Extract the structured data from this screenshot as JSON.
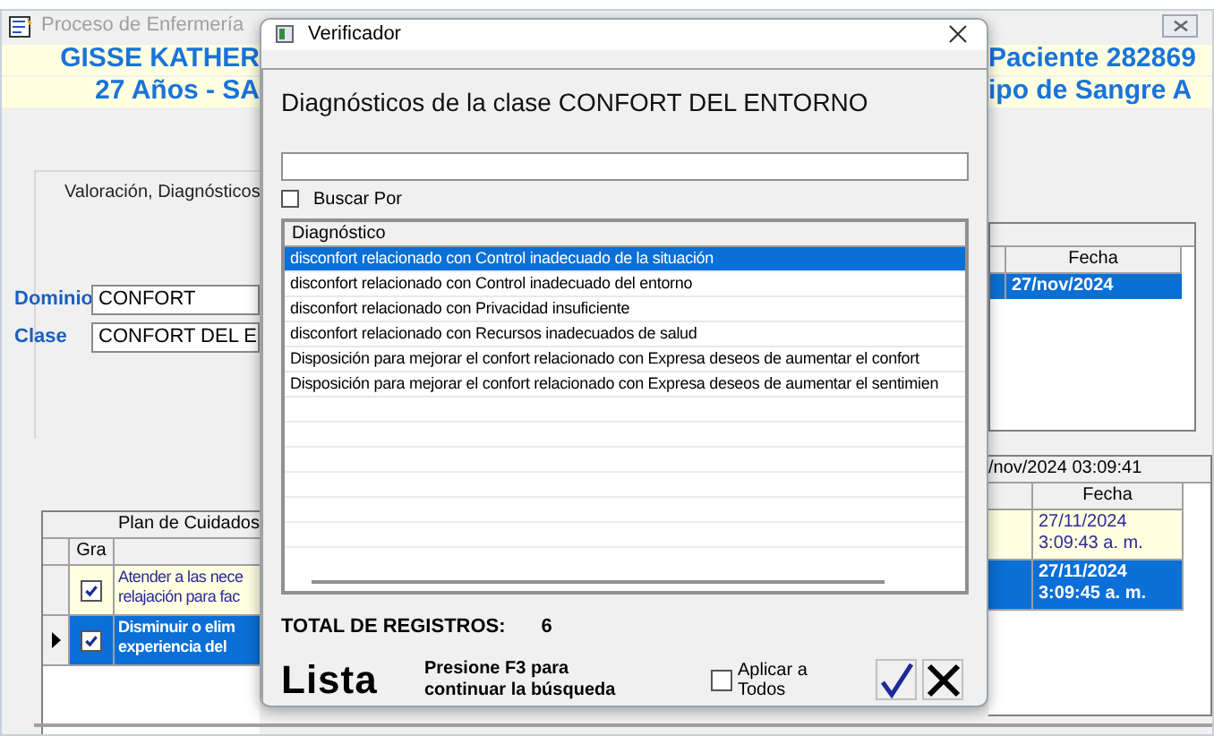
{
  "main_window": {
    "title": "Proceso de Enfermería",
    "header_left": [
      "GISSE KATHER",
      "27 Años  -  SA"
    ],
    "header_right": [
      "Paciente 282869",
      "ipo de Sangre A"
    ],
    "group_title": "Valoración, Diagnósticos",
    "fields": [
      {
        "label": "Dominio",
        "value": "CONFORT"
      },
      {
        "label": "Clase",
        "value": "CONFORT DEL E"
      }
    ],
    "diag_table": {
      "column": "Fecha",
      "rows": [
        {
          "fecha": "27/nov/2024",
          "selected": true
        }
      ]
    },
    "plan_table": {
      "title_left": "Plan de Cuidados",
      "title_right": "/nov/2024  03:09:41",
      "column_left": "Gra",
      "column_right": "Fecha",
      "rows": [
        {
          "checked": true,
          "selected": false,
          "text": [
            "Atender a las nece",
            "relajación para fac"
          ],
          "fecha": [
            "27/11/2024",
            "3:09:43 a. m."
          ]
        },
        {
          "checked": true,
          "selected": true,
          "text": [
            "Disminuir o elim",
            "experiencia del"
          ],
          "fecha": [
            "27/11/2024",
            "3:09:45 a. m."
          ]
        }
      ]
    }
  },
  "dialog": {
    "title": "Verificador",
    "heading": "Diagnósticos de la clase CONFORT DEL ENTORNO",
    "buscar_por": {
      "label": "Buscar Por",
      "checked": false
    },
    "list": {
      "column": "Diagnóstico",
      "rows": [
        {
          "text": "disconfort relacionado con Control inadecuado de la situación",
          "selected": true
        },
        {
          "text": "disconfort relacionado con Control inadecuado del entorno",
          "selected": false
        },
        {
          "text": "disconfort relacionado con Privacidad insuficiente",
          "selected": false
        },
        {
          "text": "disconfort relacionado con Recursos inadecuados de salud",
          "selected": false
        },
        {
          "text": "Disposición para mejorar el confort relacionado con Expresa deseos de aumentar el confort",
          "selected": false
        },
        {
          "text": "Disposición para mejorar el confort relacionado con Expresa deseos de aumentar el sentimien",
          "selected": false
        }
      ]
    },
    "total_label": "TOTAL DE REGISTROS:",
    "total_value": "6",
    "mode": "Lista",
    "hint": [
      "Presione F3 para",
      "continuar la búsqueda"
    ],
    "aplicar": {
      "label": [
        "Aplicar a",
        "Todos"
      ],
      "checked": false
    }
  }
}
